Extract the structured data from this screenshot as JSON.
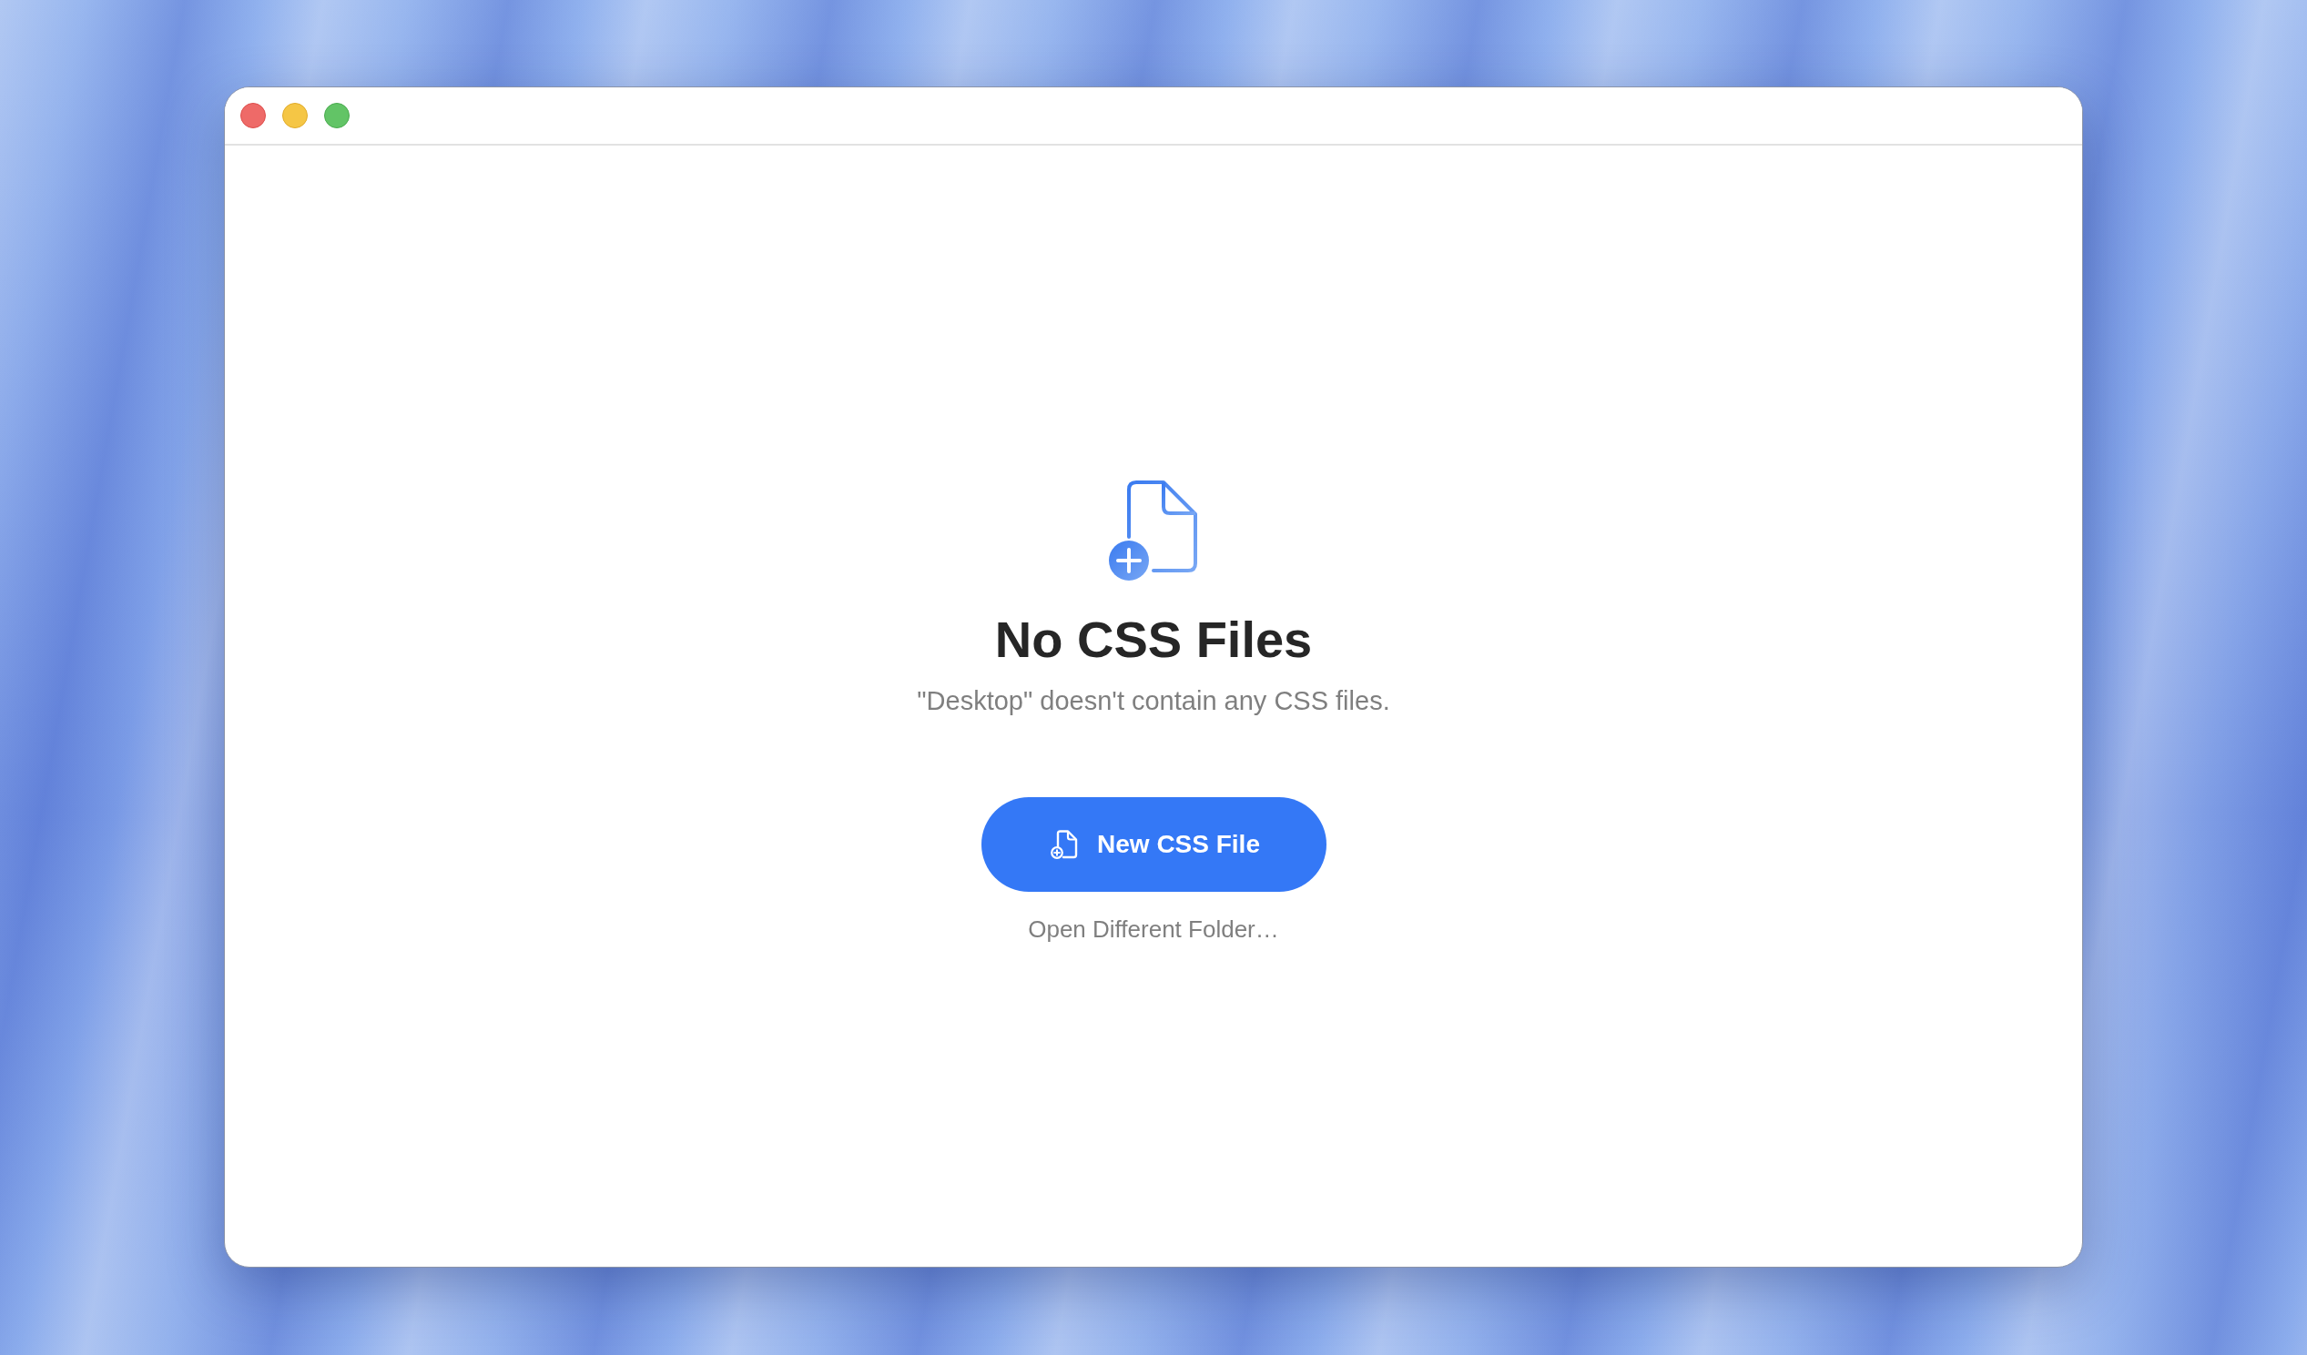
{
  "window": {
    "controls": [
      {
        "kind": "close"
      },
      {
        "kind": "minimize"
      },
      {
        "kind": "zoom"
      }
    ]
  },
  "empty_state": {
    "title": "No CSS Files",
    "message": "\"Desktop\" doesn't contain any CSS files.",
    "primary_button": {
      "label": "New CSS File"
    },
    "link": {
      "label": "Open Different Folder…"
    }
  }
}
